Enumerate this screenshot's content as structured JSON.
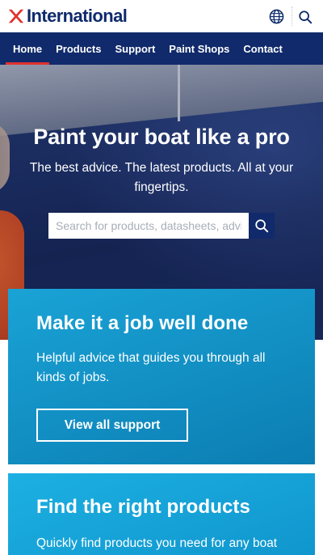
{
  "header": {
    "brand": "International",
    "icons": {
      "logo_mark": "x-logo-icon",
      "language": "globe-icon",
      "search": "search-icon"
    },
    "colors": {
      "brand_blue": "#0f2a6b",
      "brand_red": "#e3312d"
    }
  },
  "nav": {
    "items": [
      {
        "label": "Home",
        "active": true
      },
      {
        "label": "Products",
        "active": false
      },
      {
        "label": "Support",
        "active": false
      },
      {
        "label": "Paint Shops",
        "active": false
      },
      {
        "label": "Contact",
        "active": false
      }
    ]
  },
  "hero": {
    "title": "Paint your boat like a pro",
    "subtitle": "The best advice. The latest products. All at your fingertips.",
    "search_placeholder": "Search for products, datasheets, advice",
    "search_button_icon": "search-icon"
  },
  "cards": [
    {
      "title_light": "Make it a ",
      "title_bold": "job well done",
      "text": "Helpful advice that guides you through all kinds of jobs.",
      "button_label": "View all support"
    },
    {
      "title_light": "Find the ",
      "title_bold": "right products",
      "text": "Quickly find products you need for any boat"
    }
  ]
}
